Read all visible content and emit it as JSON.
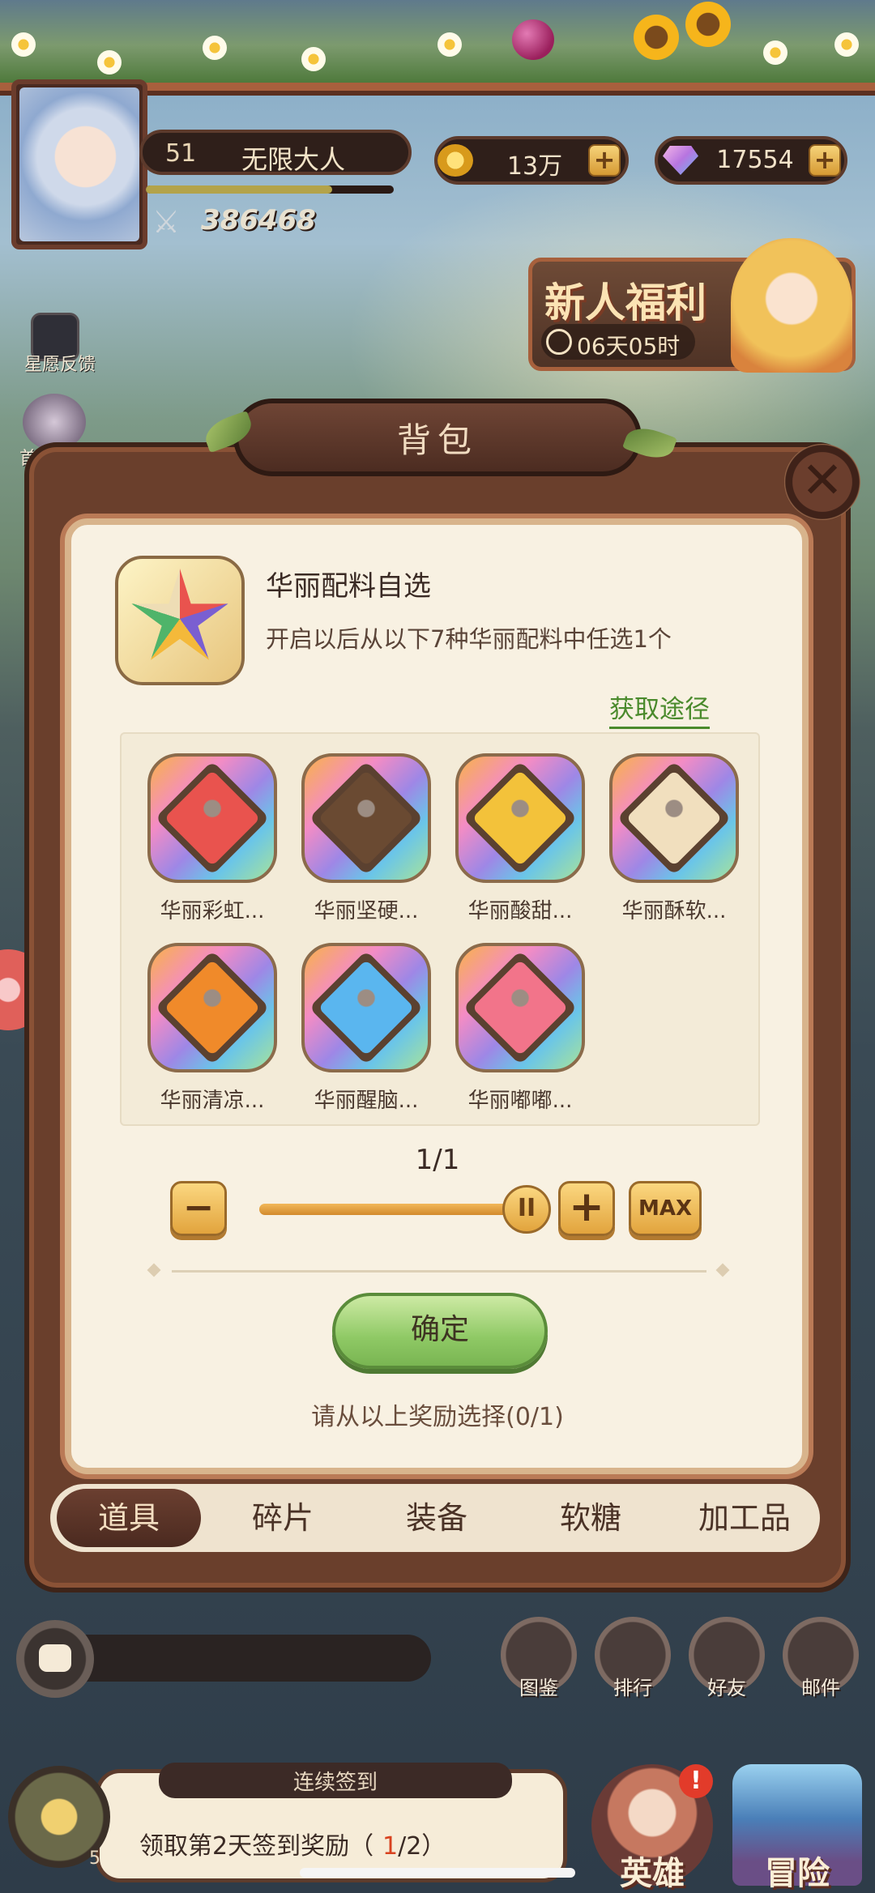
{
  "hud": {
    "level": "51",
    "player_name": "无限大人",
    "power": "386468",
    "gold": "13万",
    "gems": "17554",
    "plus": "+"
  },
  "side": {
    "feedback_label": "星愿反馈",
    "firstpay_label": "首充福"
  },
  "newbie": {
    "title": "新人福利",
    "timer": "06天05时"
  },
  "modal": {
    "title": "背包",
    "close": "✕",
    "item": {
      "name": "华丽配料自选",
      "description": "开启以后从以下7种华丽配料中任选1个",
      "obtain_link": "获取途径"
    },
    "options": [
      {
        "label": "华丽彩虹...",
        "color": "#e9534e"
      },
      {
        "label": "华丽坚硬...",
        "color": "#6a4a32"
      },
      {
        "label": "华丽酸甜...",
        "color": "#f3c23a"
      },
      {
        "label": "华丽酥软...",
        "color": "#f1dfbe"
      },
      {
        "label": "华丽清凉...",
        "color": "#f08a2a"
      },
      {
        "label": "华丽醒脑...",
        "color": "#5ab6ef"
      },
      {
        "label": "华丽嘟嘟...",
        "color": "#f2748a"
      }
    ],
    "quantity": "1/1",
    "quantity_fraction": 1.0,
    "minus": "−",
    "plus": "+",
    "max": "MAX",
    "slider_thumb": "II",
    "confirm": "确定",
    "select_hint": "请从以上奖励选择(0/1)"
  },
  "tabs": [
    {
      "label": "道具",
      "active": true
    },
    {
      "label": "碎片",
      "active": false
    },
    {
      "label": "装备",
      "active": false
    },
    {
      "label": "软糖",
      "active": false
    },
    {
      "label": "加工品",
      "active": false
    }
  ],
  "bottom": {
    "buttons": [
      {
        "label": "图鉴",
        "icon": "book-icon"
      },
      {
        "label": "排行",
        "icon": "medal-icon"
      },
      {
        "label": "好友",
        "icon": "friends-icon"
      },
      {
        "label": "邮件",
        "icon": "mail-icon"
      }
    ],
    "signin_title": "连续签到",
    "signin_text": "领取第2天签到奖励（",
    "signin_current": "1",
    "signin_total": "/2）",
    "signin_count": "5",
    "hero_label": "英雄",
    "hero_badge": "!",
    "adventure_label": "冒险"
  },
  "colors": {
    "panel_bg": "#f8f1e2",
    "frame_brown": "#6a3f2c",
    "confirm_green": "#8fc965",
    "link_green": "#4a8a2c",
    "accent_orange": "#e2a43d"
  }
}
